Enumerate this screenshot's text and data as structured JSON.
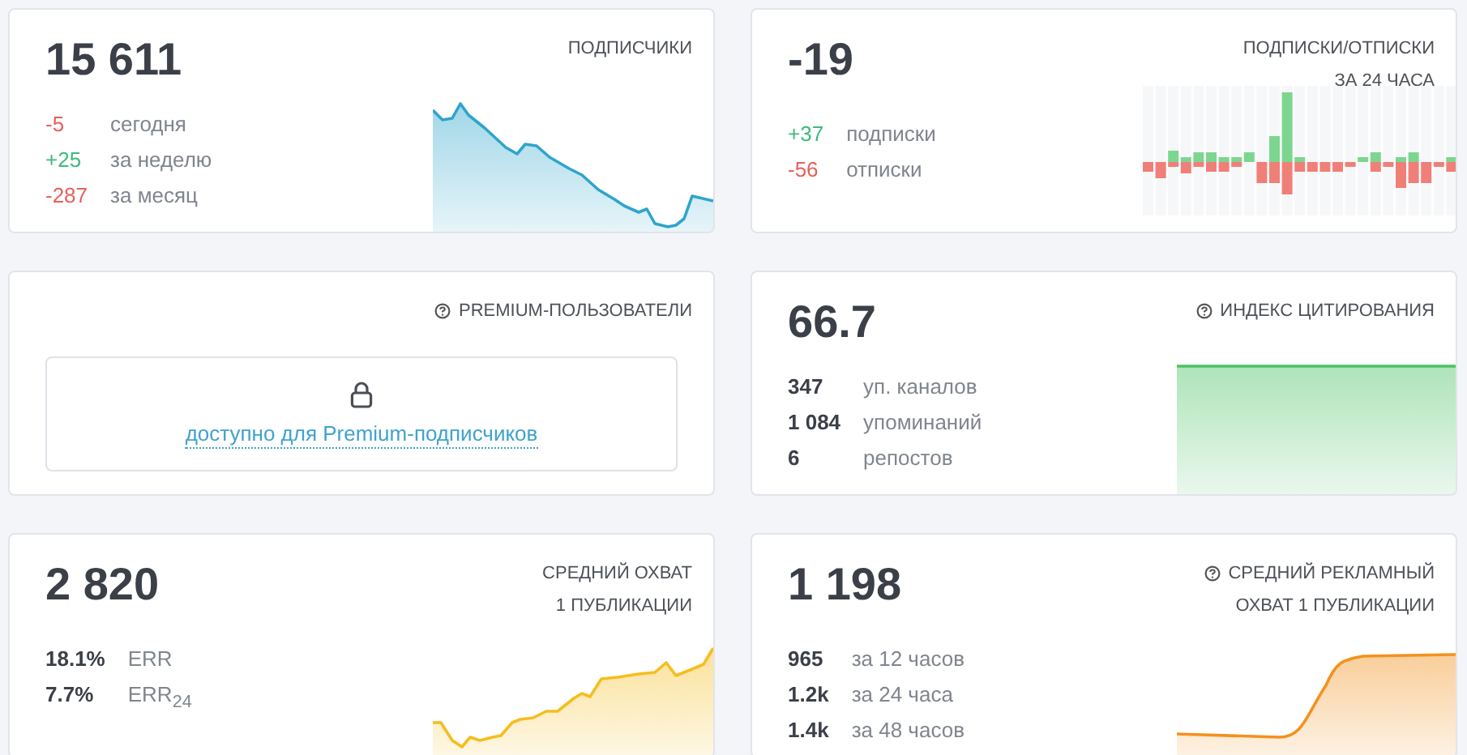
{
  "cards": [
    {
      "kind": "stats",
      "value": "15 611",
      "title": [
        "ПОДПИСЧИКИ"
      ],
      "info": false,
      "sparkline": {
        "kind": "line",
        "color": "#2ea5cc"
      },
      "stats": [
        {
          "kind": "delta",
          "value": "-5",
          "label": "сегодня",
          "color": "#e5605b"
        },
        {
          "kind": "delta",
          "value": "+25",
          "label": "за неделю",
          "color": "#3dba7c"
        },
        {
          "kind": "delta",
          "value": "-287",
          "label": "за месяц",
          "color": "#e5605b"
        }
      ]
    },
    {
      "kind": "stats",
      "value": "-19",
      "title": [
        "ПОДПИСКИ/ОТПИСКИ",
        "ЗА 24 ЧАСА"
      ],
      "info": false,
      "sparkline": {
        "kind": "bars",
        "color": "#7dd68f"
      },
      "stats": [
        {
          "kind": "delta",
          "value": "+37",
          "label": "подписки",
          "color": "#3dba7c"
        },
        {
          "kind": "delta",
          "value": "-56",
          "label": "отписки",
          "color": "#e5605b"
        }
      ]
    },
    {
      "kind": "locked",
      "title": [
        "PREMIUM-ПОЛЬЗОВАТЕЛИ"
      ],
      "info": true,
      "link": "доступно для Premium-подписчиков"
    },
    {
      "kind": "stats",
      "value": "66.7",
      "title": [
        "ИНДЕКС ЦИТИРОВАНИЯ"
      ],
      "info": true,
      "sparkline": {
        "kind": "flat",
        "color": "#4cc264"
      },
      "stats": [
        {
          "kind": "count",
          "value": "347",
          "label": "уп. каналов"
        },
        {
          "kind": "count",
          "value": "1 084",
          "label": "упоминаний"
        },
        {
          "kind": "count",
          "value": "6",
          "label": "репостов"
        }
      ]
    },
    {
      "kind": "stats",
      "value": "2 820",
      "title": [
        "СРЕДНИЙ ОХВАТ",
        "1 ПУБЛИКАЦИИ"
      ],
      "info": false,
      "sparkline": {
        "kind": "rising",
        "color": "#f5bd1f"
      },
      "stats": [
        {
          "kind": "count",
          "value": "18.1%",
          "label": "ERR"
        },
        {
          "kind": "count",
          "value": "7.7%",
          "label": "ERR$_{24}$"
        }
      ]
    },
    {
      "kind": "stats",
      "value": "1 198",
      "title": [
        "СРЕДНИЙ РЕКЛАМНЫЙ",
        "ОХВАТ 1 ПУБЛИКАЦИИ"
      ],
      "info": true,
      "sparkline": {
        "kind": "step",
        "color": "#f2921e"
      },
      "stats": [
        {
          "kind": "count",
          "value": "965",
          "label": "за 12 часов"
        },
        {
          "kind": "count",
          "value": "1.2k",
          "label": "за 24 часа"
        },
        {
          "kind": "count",
          "value": "1.4k",
          "label": "за 48 часов"
        }
      ]
    }
  ]
}
